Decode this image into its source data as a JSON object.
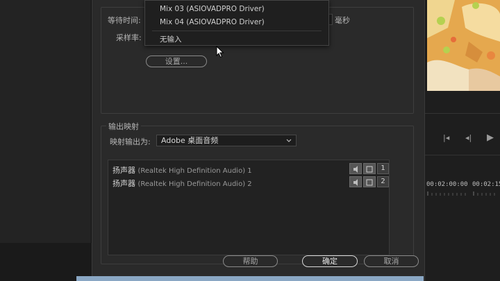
{
  "input_settings": {
    "wait_time_label": "等待时间:",
    "wait_time_unit": "毫秒",
    "sample_rate_label": "采样率:",
    "settings_button": "设置..."
  },
  "device_dropdown": {
    "items": [
      "Mix 03 (ASIOVADPRO Driver)",
      "Mix 04 (ASIOVADPRO Driver)",
      "无输入"
    ]
  },
  "output_mapping": {
    "group_title": "输出映射",
    "map_output_label": "映射输出为:",
    "map_output_value": "Adobe 桌面音频",
    "channels": [
      {
        "name": "扬声器",
        "device": "(Realtek High Definition Audio) 1",
        "number": "1"
      },
      {
        "name": "扬声器",
        "device": "(Realtek High Definition Audio) 2",
        "number": "2"
      }
    ]
  },
  "dialog_buttons": {
    "help": "帮助",
    "ok": "确定",
    "cancel": "取消"
  },
  "timeline": {
    "timecode_1": "00:02:00:00",
    "timecode_2": "00:02:15"
  },
  "colors": {
    "dialog_bg": "#2a2a2a",
    "app_bg": "#1b1b1b",
    "accent_preview": "#e9b25a"
  }
}
